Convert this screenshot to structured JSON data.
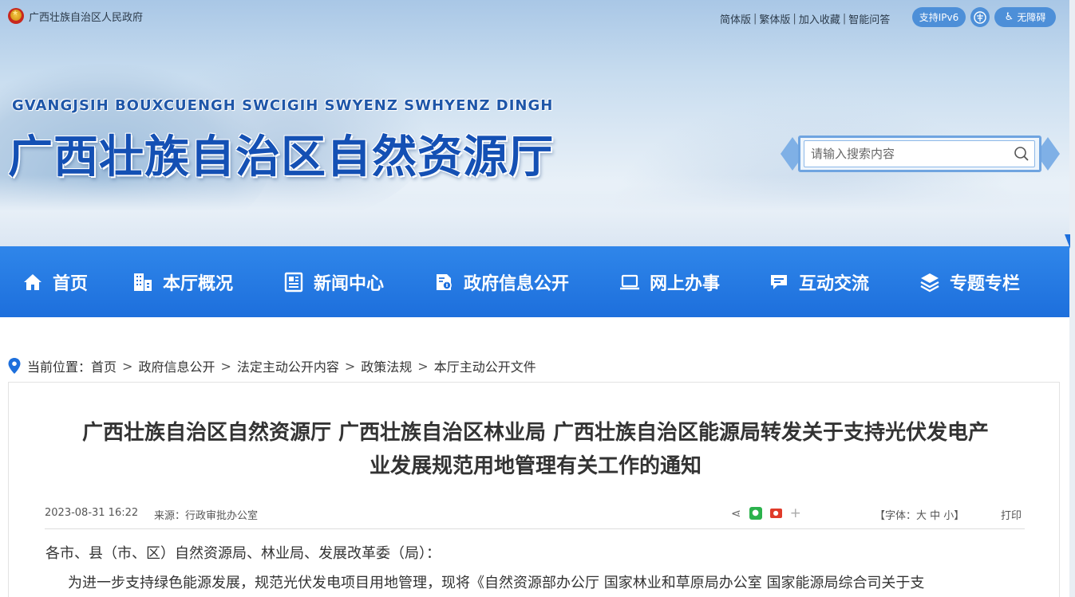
{
  "topbar": {
    "gov_name": "广西壮族自治区人民政府",
    "links": [
      "简体版",
      "繁体版",
      "加入收藏",
      "智能问答"
    ],
    "ipv6_label": "支持IPv6",
    "accessibility_label": "无障碍"
  },
  "site": {
    "name_en": "GVANGJSIH BOUXCUENGH SWCIGIH SWYENZ SWHYENZ DINGH",
    "name_cn": "广西壮族自治区自然资源厅"
  },
  "search": {
    "placeholder": "请输入搜索内容"
  },
  "nav": {
    "items": [
      {
        "label": "首页",
        "icon": "home-icon"
      },
      {
        "label": "本厅概况",
        "icon": "building-icon"
      },
      {
        "label": "新闻中心",
        "icon": "newspaper-icon"
      },
      {
        "label": "政府信息公开",
        "icon": "info-doc-icon"
      },
      {
        "label": "网上办事",
        "icon": "laptop-icon"
      },
      {
        "label": "互动交流",
        "icon": "chat-icon"
      },
      {
        "label": "专题专栏",
        "icon": "layers-icon"
      }
    ]
  },
  "breadcrumb": {
    "prefix": "当前位置：",
    "items": [
      "首页",
      "政府信息公开",
      "法定主动公开内容",
      "政策法规",
      "本厅主动公开文件"
    ],
    "separator": ">"
  },
  "article": {
    "title_line1": "广西壮族自治区自然资源厅 广西壮族自治区林业局 广西壮族自治区能源局转发关于支持光伏发电产",
    "title_line2": "业发展规范用地管理有关工作的通知",
    "date": "2023-08-31 16:22",
    "source": "来源：行政审批办公室",
    "font_size_label": "【字体：大 中 小】",
    "print_label": "打印",
    "paragraph1": "各市、县（市、区）自然资源局、林业局、发展改革委（局）：",
    "paragraph2": "为进一步支持绿色能源发展，规范光伏发电项目用地管理，现将《自然资源部办公厅 国家林业和草原局办公室 国家能源局综合司关于支"
  },
  "colors": {
    "nav_bg": "#1d6fdc",
    "title_blue": "#1450b4",
    "pill_blue": "#4d8fd8"
  }
}
